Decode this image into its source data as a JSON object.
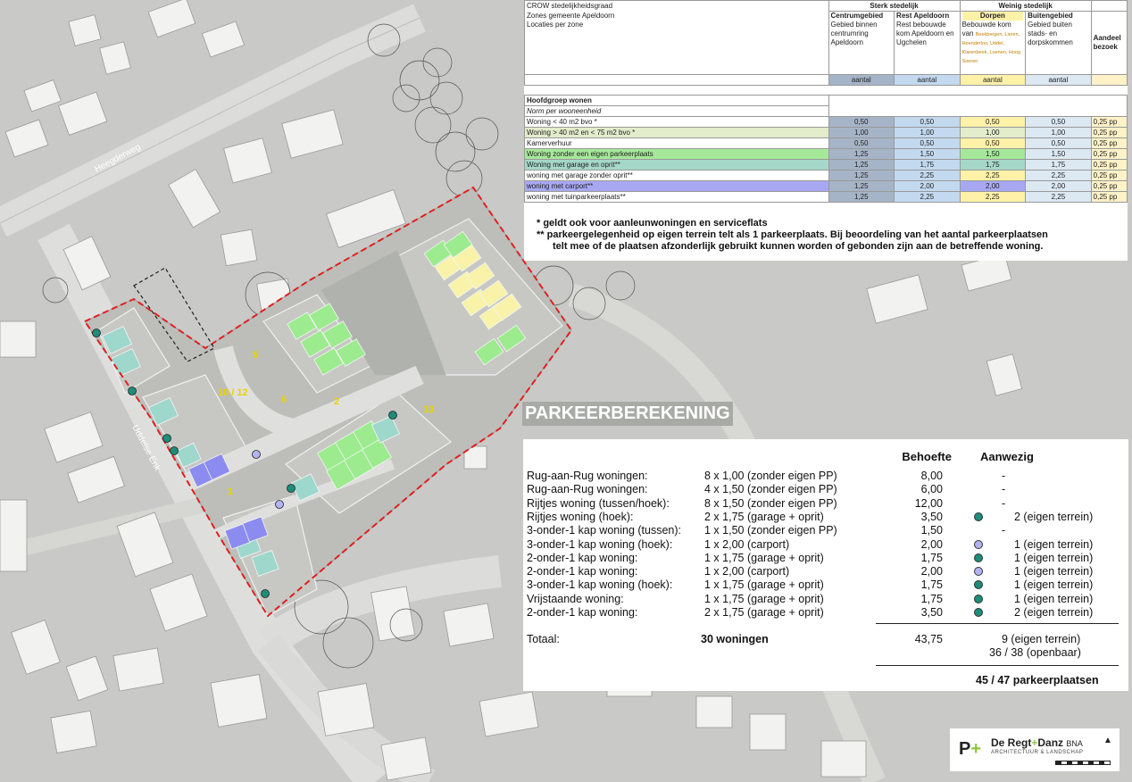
{
  "map": {
    "street_1": "Heegderweg",
    "street_2": "Uddelse Enk",
    "zone_labels": [
      "5",
      "10 / 12",
      "6",
      "2",
      "13",
      "1"
    ]
  },
  "crow": {
    "title": "CROW stedelijkheidsgraad",
    "zones_label": "Zones gemeente Apeldoorn",
    "loc_label": "Locaties per zone",
    "group_strong": "Sterk stedelijk",
    "group_weak": "Weinig stedelijk",
    "columns": [
      {
        "name": "Centrumgebied",
        "desc": "Gebied binnen centrumring Apeldoorn",
        "color": "#a6b4c8"
      },
      {
        "name": "Rest Apeldoorn",
        "desc": "Rest bebouwde kom Apeldoorn en Ugchelen",
        "color": "#c3d9ef"
      },
      {
        "name": "Dorpen",
        "desc": "Bebouwde kom van",
        "desc_small": "Beekbergen, Lieren, Hoenderloo, Uddel, Klarenbeek, Loenen, Hoog Soeren",
        "color": "#fff2a8"
      },
      {
        "name": "Buitengebied",
        "desc": "Gebied buiten stads- en dorpskommen",
        "color": "#dce8f2"
      }
    ],
    "aandeel": "Aandeel bezoek",
    "aantal": "aantal",
    "hoofdgroep": "Hoofdgroep wonen",
    "norm": "Norm per wooneenheid",
    "rows": [
      {
        "label": "Woning < 40 m2 bvo *",
        "values": [
          "0,50",
          "0,50",
          "0,50",
          "0,50"
        ],
        "visit": "0,25 pp",
        "bg": "#ffffff"
      },
      {
        "label": "Woning > 40 m2 en < 75 m2 bvo *",
        "values": [
          "1,00",
          "1,00",
          "1,00",
          "1,00"
        ],
        "visit": "0,25 pp",
        "bg": "#e3eccb"
      },
      {
        "label": "Kamerverhuur",
        "values": [
          "0,50",
          "0,50",
          "0,50",
          "0,50"
        ],
        "visit": "0,25 pp",
        "bg": "#ffffff"
      },
      {
        "label": "Woning zonder een eigen parkeerplaats",
        "values": [
          "1,25",
          "1,50",
          "1,50",
          "1,50"
        ],
        "visit": "0,25 pp",
        "bg": "#a6e89a"
      },
      {
        "label": "Woning met garage en oprit**",
        "values": [
          "1,25",
          "1,75",
          "1,75",
          "1,75"
        ],
        "visit": "0,25 pp",
        "bg": "#a5d8c8"
      },
      {
        "label": "woning met garage zonder oprit**",
        "values": [
          "1,25",
          "2,25",
          "2,25",
          "2,25"
        ],
        "visit": "0,25 pp",
        "bg": "#ffffff"
      },
      {
        "label": "woning met carport**",
        "values": [
          "1,25",
          "2,00",
          "2,00",
          "2,00"
        ],
        "visit": "0,25 pp",
        "bg": "#a8a8f2"
      },
      {
        "label": "woning met tuinparkeerplaats**",
        "values": [
          "1,25",
          "2,25",
          "2,25",
          "2,25"
        ],
        "visit": "0,25 pp",
        "bg": "#ffffff"
      }
    ]
  },
  "notes": {
    "n1": "*   geldt ook voor aanleunwoningen en serviceflats",
    "n2": "**  parkeergelegenheid op eigen terrein telt als 1 parkeerplaats. Bij beoordeling van het aantal parkeerplaatsen",
    "n3": "telt mee of de plaatsen afzonderlijk gebruikt kunnen worden of gebonden zijn aan de betreffende woning."
  },
  "parking": {
    "title": "PARKEERBEREKENING",
    "col_behoefte": "Behoefte",
    "col_aanwezig": "Aanwezig",
    "rows": [
      {
        "type": "Rug-aan-Rug woningen:",
        "calc": "8 x 1,00 (zonder eigen PP)",
        "need": "8,00",
        "present": "-",
        "dot": ""
      },
      {
        "type": "Rug-aan-Rug woningen:",
        "calc": "4 x 1,50 (zonder eigen PP)",
        "need": "6,00",
        "present": "-",
        "dot": ""
      },
      {
        "type": "Rijtjes woning (tussen/hoek):",
        "calc": "8 x 1,50 (zonder eigen PP)",
        "need": "12,00",
        "present": "-",
        "dot": ""
      },
      {
        "type": "Rijtjes woning (hoek):",
        "calc": "2 x 1,75 (garage + oprit)",
        "need": "3,50",
        "present": "2 (eigen terrein)",
        "dot": "#1e8c78"
      },
      {
        "type": "3-onder-1 kap woning (tussen):",
        "calc": "1 x 1,50 (zonder eigen PP)",
        "need": "1,50",
        "present": "-",
        "dot": ""
      },
      {
        "type": "3-onder-1 kap woning (hoek):",
        "calc": "1 x 2,00 (carport)",
        "need": "2,00",
        "present": "1 (eigen terrein)",
        "dot": "#b3b3f2"
      },
      {
        "type": "2-onder-1 kap woning:",
        "calc": "1 x 1,75 (garage + oprit)",
        "need": "1,75",
        "present": "1 (eigen terrein)",
        "dot": "#1e8c78"
      },
      {
        "type": "2-onder-1 kap woning:",
        "calc": "1 x 2,00 (carport)",
        "need": "2,00",
        "present": "1 (eigen terrein)",
        "dot": "#b3b3f2"
      },
      {
        "type": "3-onder-1 kap woning (hoek):",
        "calc": "1 x 1,75 (garage + oprit)",
        "need": "1,75",
        "present": "1 (eigen terrein)",
        "dot": "#1e8c78"
      },
      {
        "type": "Vrijstaande woning:",
        "calc": "1 x 1,75 (garage + oprit)",
        "need": "1,75",
        "present": "1 (eigen terrein)",
        "dot": "#1e8c78"
      },
      {
        "type": "2-onder-1 kap woning:",
        "calc": "2 x 1,75 (garage + oprit)",
        "need": "3,50",
        "present": "2 (eigen terrein)",
        "dot": "#1e8c78"
      }
    ],
    "total_label": "Totaal:",
    "total_houses": "30 woningen",
    "total_need": "43,75",
    "total_private": "9 (eigen terrein)",
    "total_public": "36 / 38 (openbaar)",
    "grand_total": "45 / 47 parkeerplaatsen"
  },
  "logo": {
    "name_a": "De Regt",
    "name_plus": "+",
    "name_b": "Danz",
    "suffix": "BNA",
    "sub": "ARCHITECTUUR & LANDSCHAP"
  }
}
